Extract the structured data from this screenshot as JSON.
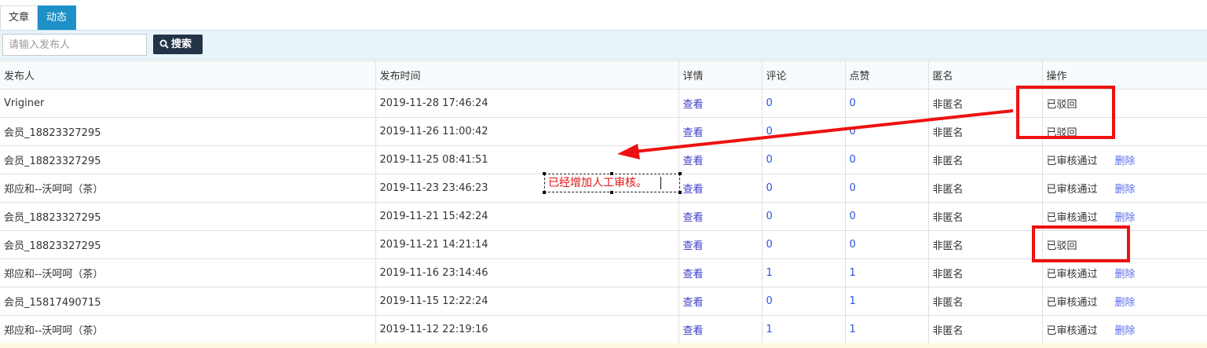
{
  "tabs": [
    {
      "label": "文章",
      "active": false
    },
    {
      "label": "动态",
      "active": true
    }
  ],
  "search": {
    "placeholder": "请输入发布人",
    "button_label": "搜索"
  },
  "table": {
    "headers": [
      "发布人",
      "发布时间",
      "详情",
      "评论",
      "点赞",
      "匿名",
      "操作"
    ],
    "rows": [
      {
        "publisher": "Vriginer",
        "time": "2019-11-28 17:46:24",
        "detail": "查看",
        "comments": "0",
        "likes": "0",
        "anonymous": "非匿名",
        "status": "已驳回",
        "delete": ""
      },
      {
        "publisher": "会员_18823327295",
        "time": "2019-11-26 11:00:42",
        "detail": "查看",
        "comments": "0",
        "likes": "0",
        "anonymous": "非匿名",
        "status": "已驳回",
        "delete": ""
      },
      {
        "publisher": "会员_18823327295",
        "time": "2019-11-25 08:41:51",
        "detail": "查看",
        "comments": "0",
        "likes": "0",
        "anonymous": "非匿名",
        "status": "已审核通过",
        "delete": "删除"
      },
      {
        "publisher": "郑应和--沃呵呵（茶）",
        "time": "2019-11-23 23:46:23",
        "detail": "查看",
        "comments": "0",
        "likes": "0",
        "anonymous": "非匿名",
        "status": "已审核通过",
        "delete": "删除"
      },
      {
        "publisher": "会员_18823327295",
        "time": "2019-11-21 15:42:24",
        "detail": "查看",
        "comments": "0",
        "likes": "0",
        "anonymous": "非匿名",
        "status": "已审核通过",
        "delete": "删除"
      },
      {
        "publisher": "会员_18823327295",
        "time": "2019-11-21 14:21:14",
        "detail": "查看",
        "comments": "0",
        "likes": "0",
        "anonymous": "非匿名",
        "status": "已驳回",
        "delete": ""
      },
      {
        "publisher": "郑应和--沃呵呵（茶）",
        "time": "2019-11-16 23:14:46",
        "detail": "查看",
        "comments": "1",
        "likes": "1",
        "anonymous": "非匿名",
        "status": "已审核通过",
        "delete": "删除"
      },
      {
        "publisher": "会员_15817490715",
        "time": "2019-11-15 12:22:24",
        "detail": "查看",
        "comments": "0",
        "likes": "1",
        "anonymous": "非匿名",
        "status": "已审核通过",
        "delete": "删除"
      },
      {
        "publisher": "郑应和--沃呵呵（茶）",
        "time": "2019-11-12 22:19:16",
        "detail": "查看",
        "comments": "1",
        "likes": "1",
        "anonymous": "非匿名",
        "status": "已审核通过",
        "delete": "删除"
      }
    ]
  },
  "annotation": {
    "note": "已经增加人工审核。",
    "highlight_color": "#ee1111"
  },
  "colors": {
    "active_tab": "#1e90c8",
    "search_button": "#243447",
    "link": "#3c3cc8",
    "number": "#2a52d9"
  }
}
